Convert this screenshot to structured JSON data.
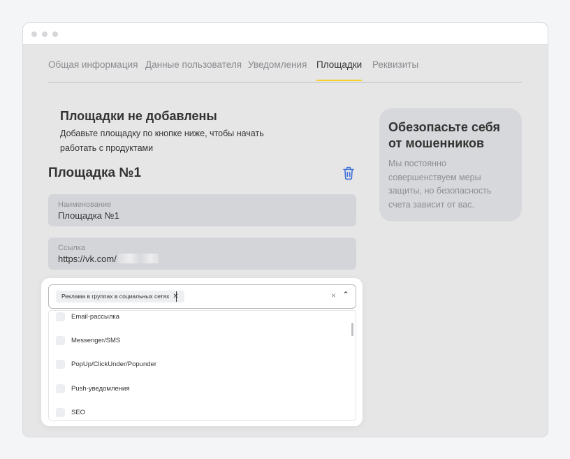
{
  "tabs": [
    {
      "label": "Общая информация"
    },
    {
      "label": "Данные пользователя"
    },
    {
      "label": "Уведомления"
    },
    {
      "label": "Площадки",
      "active": true
    },
    {
      "label": "Реквизиты"
    }
  ],
  "empty_state": {
    "title": "Площадки не добавлены",
    "text": "Добавьте площадку по кнопке ниже, чтобы начать работать с продуктами"
  },
  "place": {
    "title": "Площадка №1",
    "delete_icon": "trash-icon",
    "name_field": {
      "label": "Наименование",
      "value": "Площадка №1"
    },
    "link_field": {
      "label": "Ссылка",
      "value": "https://vk.com/"
    }
  },
  "security_card": {
    "title": "Обезопасьте себя от мошенников",
    "text": "Мы постоянно совершенствуем меры защиты, но безопасность счета зависит от вас."
  },
  "dropdown": {
    "selected_chip": "Реклама в группах в социальных сетях",
    "chip_remove_icon": "✕",
    "clear_icon": "×",
    "toggle_icon": "⌃",
    "options": [
      {
        "label": "Email-рассылка"
      },
      {
        "label": "Messenger/SMS"
      },
      {
        "label": "PopUp/ClickUnder/Popunder"
      },
      {
        "label": "Push-уведомления"
      },
      {
        "label": "SEO"
      }
    ]
  },
  "colors": {
    "accent": "#f5d02a",
    "delete_icon": "#3e6fd8"
  }
}
